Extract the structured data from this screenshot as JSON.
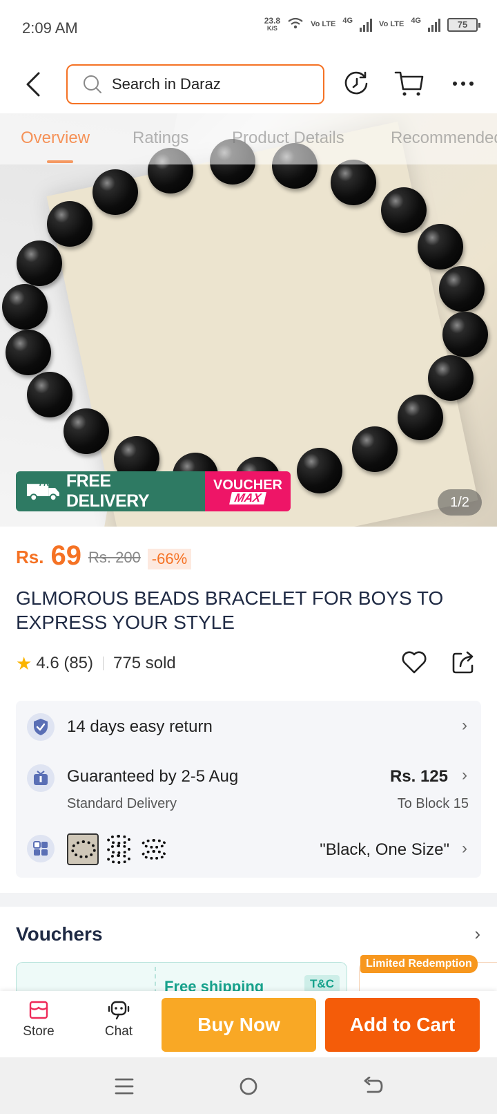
{
  "status_bar": {
    "time": "2:09 AM",
    "net_speed": "23.8",
    "net_unit": "K/S",
    "sim1": "Vo LTE",
    "sim1_gen": "4G",
    "sim2": "Vo LTE",
    "sim2_gen": "4G",
    "battery": "75"
  },
  "header": {
    "search_placeholder": "Search in Daraz",
    "icons": [
      "back-icon",
      "search-icon",
      "history-icon",
      "cart-icon",
      "more-icon"
    ]
  },
  "tabs": [
    {
      "label": "Overview",
      "active": true
    },
    {
      "label": "Ratings",
      "active": false
    },
    {
      "label": "Product Details",
      "active": false
    },
    {
      "label": "Recommended",
      "active": false
    }
  ],
  "gallery": {
    "promo_badge": "FREE",
    "promo_free_delivery": "FREE DELIVERY",
    "promo_voucher_line1": "VOUCHER",
    "promo_voucher_line2": "MAX",
    "page_counter": "1/2"
  },
  "price": {
    "currency": "Rs.",
    "value": "69",
    "original": "Rs. 200",
    "discount": "-66%"
  },
  "product": {
    "title": "GLMOROUS BEADS BRACELET FOR BOYS TO EXPRESS YOUR STYLE",
    "rating": "4.6 (85)",
    "sold": "775 sold"
  },
  "info": {
    "return_text": "14 days easy return",
    "delivery_text": "Guaranteed by 2-5 Aug",
    "delivery_sub": "Standard Delivery",
    "shipping_price": "Rs. 125",
    "shipping_to": "To Block 15",
    "variant_text": "\"Black, One Size\""
  },
  "vouchers": {
    "title": "Vouchers",
    "card1_label": "Free shipping",
    "card1_tnc": "T&C",
    "limited_badge": "Limited Redemption"
  },
  "actions": {
    "store": "Store",
    "chat": "Chat",
    "buy_now": "Buy Now",
    "add_to_cart": "Add to Cart"
  },
  "colors": {
    "accent": "#f57224",
    "buy_now": "#f9a825",
    "add_to_cart": "#f45c09",
    "free_delivery": "#2e7a63",
    "voucher_max": "#ee1567"
  }
}
